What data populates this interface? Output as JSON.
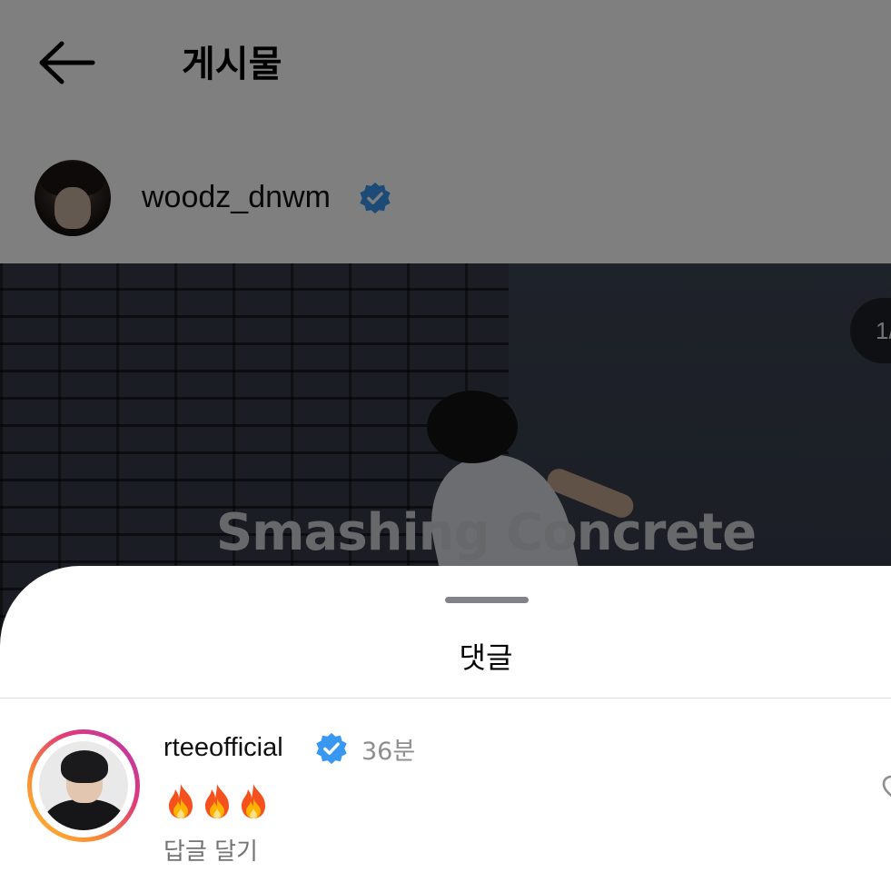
{
  "header": {
    "title": "게시물",
    "back_icon": "arrow-left-icon"
  },
  "post": {
    "author_username": "woodz_dnwm",
    "author_verified": true,
    "image_overlay_text": "Smashing Concrete",
    "image_counter": "1/"
  },
  "comments_sheet": {
    "title": "댓글",
    "comments": [
      {
        "username": "rteeofficial",
        "verified": true,
        "time": "36분",
        "text": "🔥🔥🔥",
        "reply_label": "답글 달기"
      }
    ]
  },
  "colors": {
    "verified_badge": "#3897f0",
    "story_ring_start": "#fcbf35",
    "story_ring_end": "#b735b4",
    "dim_overlay": "rgba(0,0,0,0.5)"
  }
}
